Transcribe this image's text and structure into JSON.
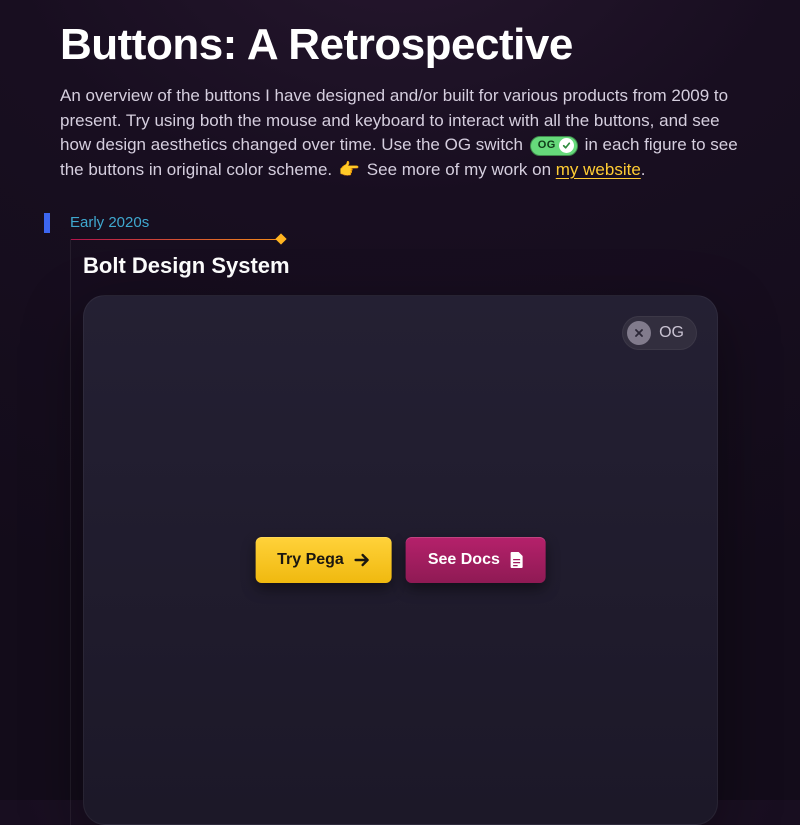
{
  "header": {
    "title": "Buttons: A Retrospective",
    "intro_part1": "An overview of the buttons I have designed and/or built for various products from 2009 to present. Try using both the mouse and keyboard to interact with all the buttons, and see how design aesthetics changed over time. Use the OG switch ",
    "og_badge_label": "OG",
    "intro_part2": "  in each figure to see the buttons in original color scheme. ",
    "pointer_emoji": "👉",
    "intro_part3": " See more of my work on ",
    "link_text": "my website",
    "intro_end": "."
  },
  "timeline": {
    "label": "Early 2020s"
  },
  "figure": {
    "title": "Bolt Design System",
    "og_toggle_label": "OG",
    "buttons": {
      "primary_label": "Try Pega",
      "secondary_label": "See Docs"
    }
  },
  "colors": {
    "accent_yellow": "#ffcc33",
    "accent_magenta": "#a51e62",
    "og_green": "#66d97b",
    "timeline_blue": "#3c66f0",
    "timeline_text": "#3fa8cf"
  }
}
